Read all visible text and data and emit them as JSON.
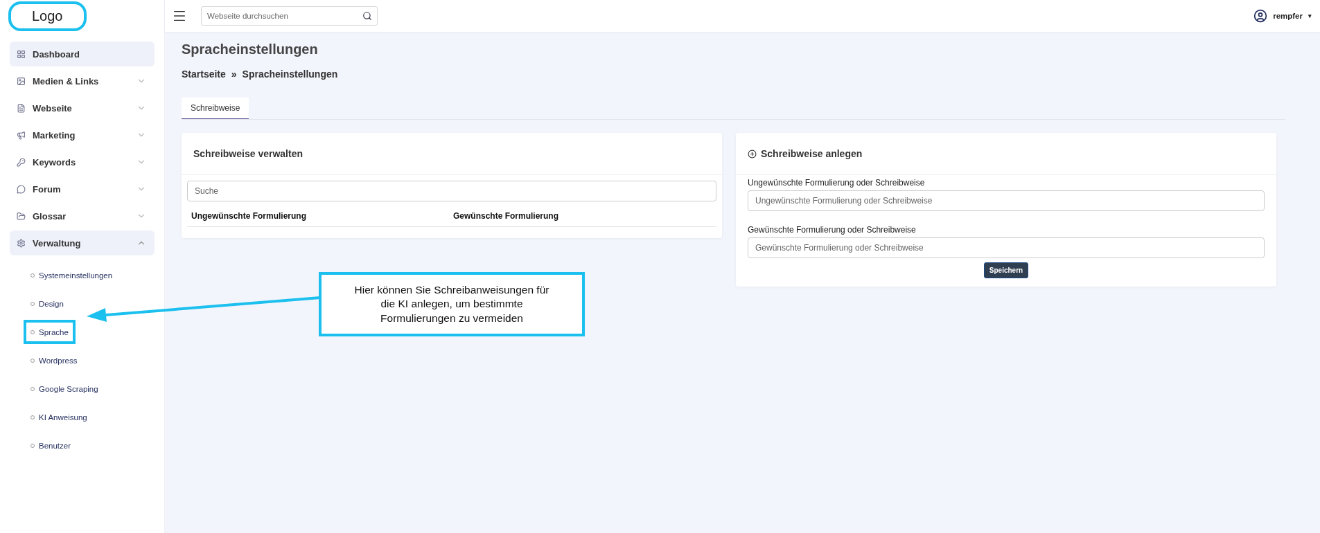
{
  "logo": {
    "text": "Logo"
  },
  "search": {
    "placeholder": "Webseite durchsuchen"
  },
  "user": {
    "name": "rempfer",
    "caret": "▾"
  },
  "sidebar": {
    "items": [
      {
        "label": "Dashboard",
        "selected": true
      },
      {
        "label": "Medien & Links",
        "selected": false,
        "expanded": false
      },
      {
        "label": "Webseite",
        "selected": false,
        "expanded": false
      },
      {
        "label": "Marketing",
        "selected": false,
        "expanded": false
      },
      {
        "label": "Keywords",
        "selected": false,
        "expanded": false
      },
      {
        "label": "Forum",
        "selected": false,
        "expanded": false
      },
      {
        "label": "Glossar",
        "selected": false,
        "expanded": false
      },
      {
        "label": "Verwaltung",
        "selected": true,
        "expanded": true,
        "children": [
          {
            "label": "Systemeinstellungen",
            "highlighted": false
          },
          {
            "label": "Design",
            "highlighted": false
          },
          {
            "label": "Sprache",
            "highlighted": true
          },
          {
            "label": "Wordpress",
            "highlighted": false
          },
          {
            "label": "Google Scraping",
            "highlighted": false
          },
          {
            "label": "KI Anweisung",
            "highlighted": false
          },
          {
            "label": "Benutzer",
            "highlighted": false
          }
        ]
      }
    ]
  },
  "page": {
    "title": "Spracheinstellungen",
    "breadcrumb": [
      "Startseite",
      "»",
      "Spracheinstellungen"
    ]
  },
  "tabs": [
    {
      "label": "Schreibweise",
      "selected": true
    }
  ],
  "manage_card": {
    "title": "Schreibweise verwalten",
    "search": {
      "placeholder": "Suche"
    },
    "columns": [
      "Ungewünschte Formulierung",
      "Gewünschte Formulierung"
    ]
  },
  "create_card": {
    "title": "Schreibweise anlegen",
    "fields": [
      {
        "label": "Ungewünschte Formulierung oder Schreibweise",
        "placeholder": "Ungewünschte Formulierung oder Schreibweise"
      },
      {
        "label": "Gewünschte Formulierung oder Schreibweise",
        "placeholder": "Gewünschte Formulierung oder Schreibweise"
      }
    ],
    "button": "Speichern"
  },
  "annotation": {
    "text": "Hier können Sie Schreibanweisungen für die KI anlegen, um bestimmte Formulierungen zu vermeiden"
  }
}
